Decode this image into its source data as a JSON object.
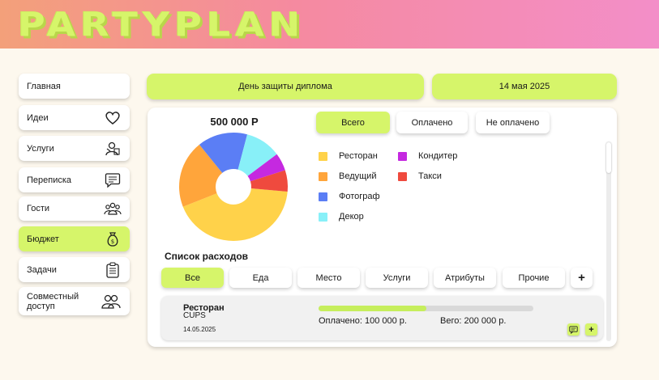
{
  "app": {
    "logo": "PARTYPLAN"
  },
  "sidebar": {
    "items": [
      {
        "label": "Главная",
        "icon": ""
      },
      {
        "label": "Идеи",
        "icon": "heart-icon"
      },
      {
        "label": "Услуги",
        "icon": "services-icon"
      },
      {
        "label": "Переписка",
        "icon": "chat-icon"
      },
      {
        "label": "Гости",
        "icon": "guests-icon"
      },
      {
        "label": "Бюджет",
        "icon": "money-bag-icon",
        "active": true
      },
      {
        "label": "Задачи",
        "icon": "clipboard-icon"
      },
      {
        "label": "Совместный доступ",
        "icon": "shared-access-icon"
      }
    ]
  },
  "event": {
    "name": "День защиты диплома",
    "date": "14 мая 2025"
  },
  "budget": {
    "total": "500 000 Р",
    "filters": [
      "Всего",
      "Оплачено",
      "Не оплачено"
    ],
    "active_filter": "Всего"
  },
  "chart_data": {
    "type": "pie",
    "variant": "donut",
    "slices": [
      {
        "label": "Ресторан",
        "value": 40,
        "color": "#ffd24a"
      },
      {
        "label": "Ведущий",
        "value": 19,
        "color": "#ffa53b"
      },
      {
        "label": "Фотограф",
        "value": 14,
        "color": "#5b7ef5"
      },
      {
        "label": "Декор",
        "value": 10,
        "color": "#88f0f8"
      },
      {
        "label": "Кондитер",
        "value": 5,
        "color": "#c529e0"
      },
      {
        "label": "Такси",
        "value": 6,
        "color": "#ef4a3e"
      }
    ],
    "legend": [
      {
        "label": "Ресторан",
        "color": "#ffd24a"
      },
      {
        "label": "Ведущий",
        "color": "#ffa53b"
      },
      {
        "label": "Фотограф",
        "color": "#5b7ef5"
      },
      {
        "label": "Декор",
        "color": "#88f0f8"
      },
      {
        "label": "Кондитер",
        "color": "#c529e0"
      },
      {
        "label": "Такси",
        "color": "#ef4a3e"
      }
    ]
  },
  "expenses": {
    "title": "Список расходов",
    "categories": [
      "Все",
      "Еда",
      "Место",
      "Услуги",
      "Атрибуты",
      "Прочие"
    ],
    "active_category": "Все",
    "add_label": "+",
    "items": [
      {
        "category": "Ресторан",
        "name": "CUPS",
        "date": "14.05.2025",
        "paid": "Оплачено: 100 000 р.",
        "total": "Вего: 200 000 р.",
        "progress": 0.5
      }
    ],
    "item_add_label": "+"
  },
  "colors": {
    "accent": "#d6f56a",
    "background": "#fdf8ee"
  }
}
